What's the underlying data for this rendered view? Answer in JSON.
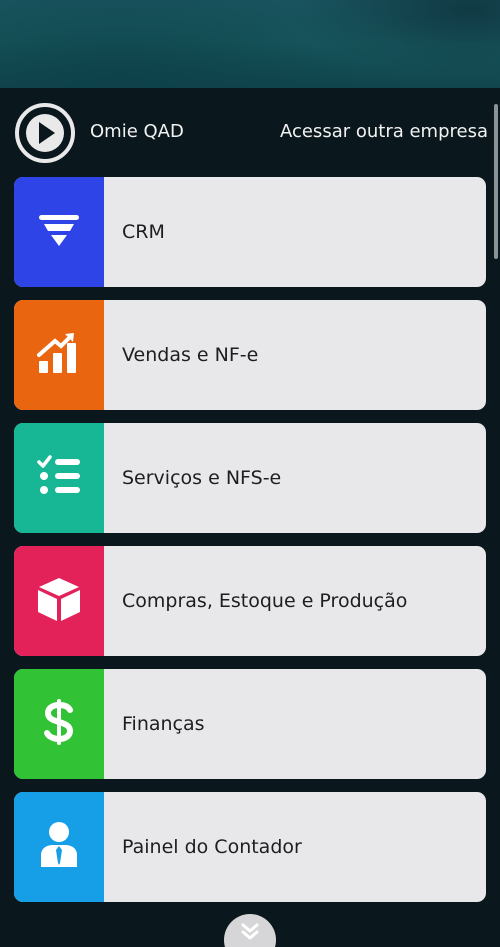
{
  "header": {
    "company_name": "Omie QAD",
    "switch_company_label": "Acessar outra empresa",
    "logo_icon": "play-circle-icon"
  },
  "modules": [
    {
      "label": "CRM",
      "icon": "funnel-icon",
      "color": "#2f44e6"
    },
    {
      "label": "Vendas e NF-e",
      "icon": "sales-chart-icon",
      "color": "#ea6510"
    },
    {
      "label": "Serviços e NFS-e",
      "icon": "checklist-icon",
      "color": "#17b795"
    },
    {
      "label": "Compras, Estoque e Produção",
      "icon": "box-icon",
      "color": "#e3225a"
    },
    {
      "label": "Finanças",
      "icon": "dollar-icon",
      "color": "#31c236"
    },
    {
      "label": "Painel do Contador",
      "icon": "accountant-icon",
      "color": "#169fe7"
    }
  ],
  "footer": {
    "more_icon": "chevron-double-down-icon"
  }
}
